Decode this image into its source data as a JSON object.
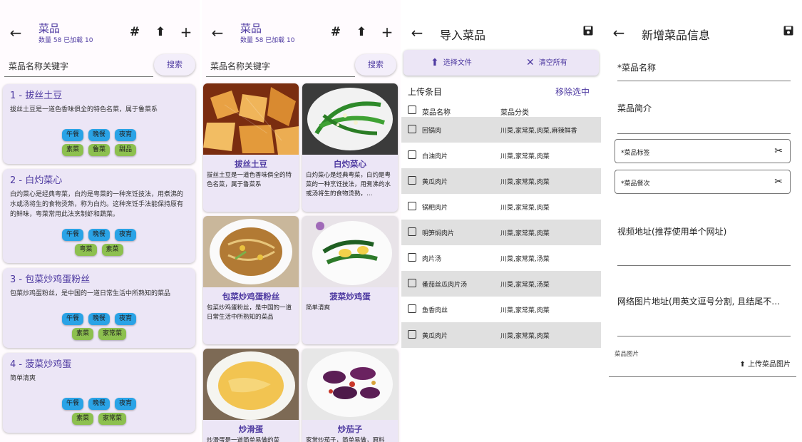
{
  "list_screen": {
    "title": "菜品",
    "subtitle": "数量 58 已加载 10",
    "search_placeholder": "菜品名称关键字",
    "search_label": "搜索",
    "items": [
      {
        "title": "1 - 拔丝土豆",
        "desc": "拔丝土豆是一道色香味俱全的特色名菜，属于鲁菜系",
        "tags1": [
          "午餐",
          "晚餐",
          "夜宵"
        ],
        "tags2": [
          "素菜",
          "鲁菜",
          "甜品"
        ]
      },
      {
        "title": "2 - 白灼菜心",
        "desc": "白灼菜心是经典粤菜，白灼是粤菜的一种烹饪技法，用煮沸的水或汤将生的食物烫熟，称为白灼。这种烹饪手法能保持原有的鲜味，粤菜常用此法烹制虾和蔬菜。",
        "tags1": [
          "午餐",
          "晚餐",
          "夜宵"
        ],
        "tags2": [
          "粤菜",
          "素菜"
        ]
      },
      {
        "title": "3 - 包菜炒鸡蛋粉丝",
        "desc": "包菜炒鸡蛋粉丝，是中国的一道日常生活中所熟知的菜品",
        "tags1": [
          "午餐",
          "晚餐",
          "夜宵"
        ],
        "tags2": [
          "素菜",
          "家常菜"
        ]
      },
      {
        "title": "4 - 菠菜炒鸡蛋",
        "desc": "简单清爽",
        "tags1": [
          "午餐",
          "晚餐",
          "夜宵"
        ],
        "tags2": [
          "素菜",
          "家常菜"
        ]
      }
    ]
  },
  "grid_screen": {
    "title": "菜品",
    "subtitle": "数量 58 已加载 10",
    "search_placeholder": "菜品名称关键字",
    "search_label": "搜索",
    "items": [
      {
        "name": "拔丝土豆",
        "desc": "拔丝土豆是一道色香味俱全的特色名菜，属于鲁菜系"
      },
      {
        "name": "白灼菜心",
        "desc": "白灼菜心是经典粤菜，白灼是粤菜的一种烹饪技法，用煮沸的水或汤将生的食物烫熟，…"
      },
      {
        "name": "包菜炒鸡蛋粉丝",
        "desc": "包菜炒鸡蛋粉丝，是中国的一道日常生活中所熟知的菜品"
      },
      {
        "name": "菠菜炒鸡蛋",
        "desc": "简单清爽"
      },
      {
        "name": "炒滑蛋",
        "desc": "炒滑蛋是一道简单易做的菜"
      },
      {
        "name": "炒茄子",
        "desc": "家常炒茄子，简单易做，原料"
      }
    ]
  },
  "import_screen": {
    "title": "导入菜品",
    "select_file": "选择文件",
    "clear_all": "清空所有",
    "upload_items": "上传条目",
    "remove_selected": "移除选中",
    "col_name": "菜品名称",
    "col_category": "菜品分类",
    "rows": [
      {
        "name": "回锅肉",
        "category": "川菜,家常菜,肉菜,麻辣鲜香"
      },
      {
        "name": "白油肉片",
        "category": "川菜,家常菜,肉菜"
      },
      {
        "name": "黄瓜肉片",
        "category": "川菜,家常菜,肉菜"
      },
      {
        "name": "锅粑肉片",
        "category": "川菜,家常菜,肉菜"
      },
      {
        "name": "明笋焖肉片",
        "category": "川菜,家常菜,肉菜"
      },
      {
        "name": "肉片汤",
        "category": "川菜,家常菜,汤菜"
      },
      {
        "name": "番茄丝瓜肉片汤",
        "category": "川菜,家常菜,汤菜"
      },
      {
        "name": "鱼香肉丝",
        "category": "川菜,家常菜,肉菜"
      },
      {
        "name": "黄瓜肉片",
        "category": "川菜,家常菜,肉菜"
      }
    ]
  },
  "new_screen": {
    "title": "新增菜品信息",
    "name_label": "*菜品名称",
    "intro_label": "菜品简介",
    "tags_label": "*菜品标签",
    "meal_label": "*菜品餐次",
    "video_label": "视频地址(推荐使用单个网址)",
    "image_url_label": "网络图片地址(用英文逗号分割, 且结尾不…",
    "image_label": "菜品图片",
    "upload_image": "上传菜品图片"
  },
  "colors": {
    "accent": "#4e3aa1",
    "card": "#ece6f6",
    "tag_blue": "#2aa3e6",
    "tag_green": "#8dc04f"
  }
}
